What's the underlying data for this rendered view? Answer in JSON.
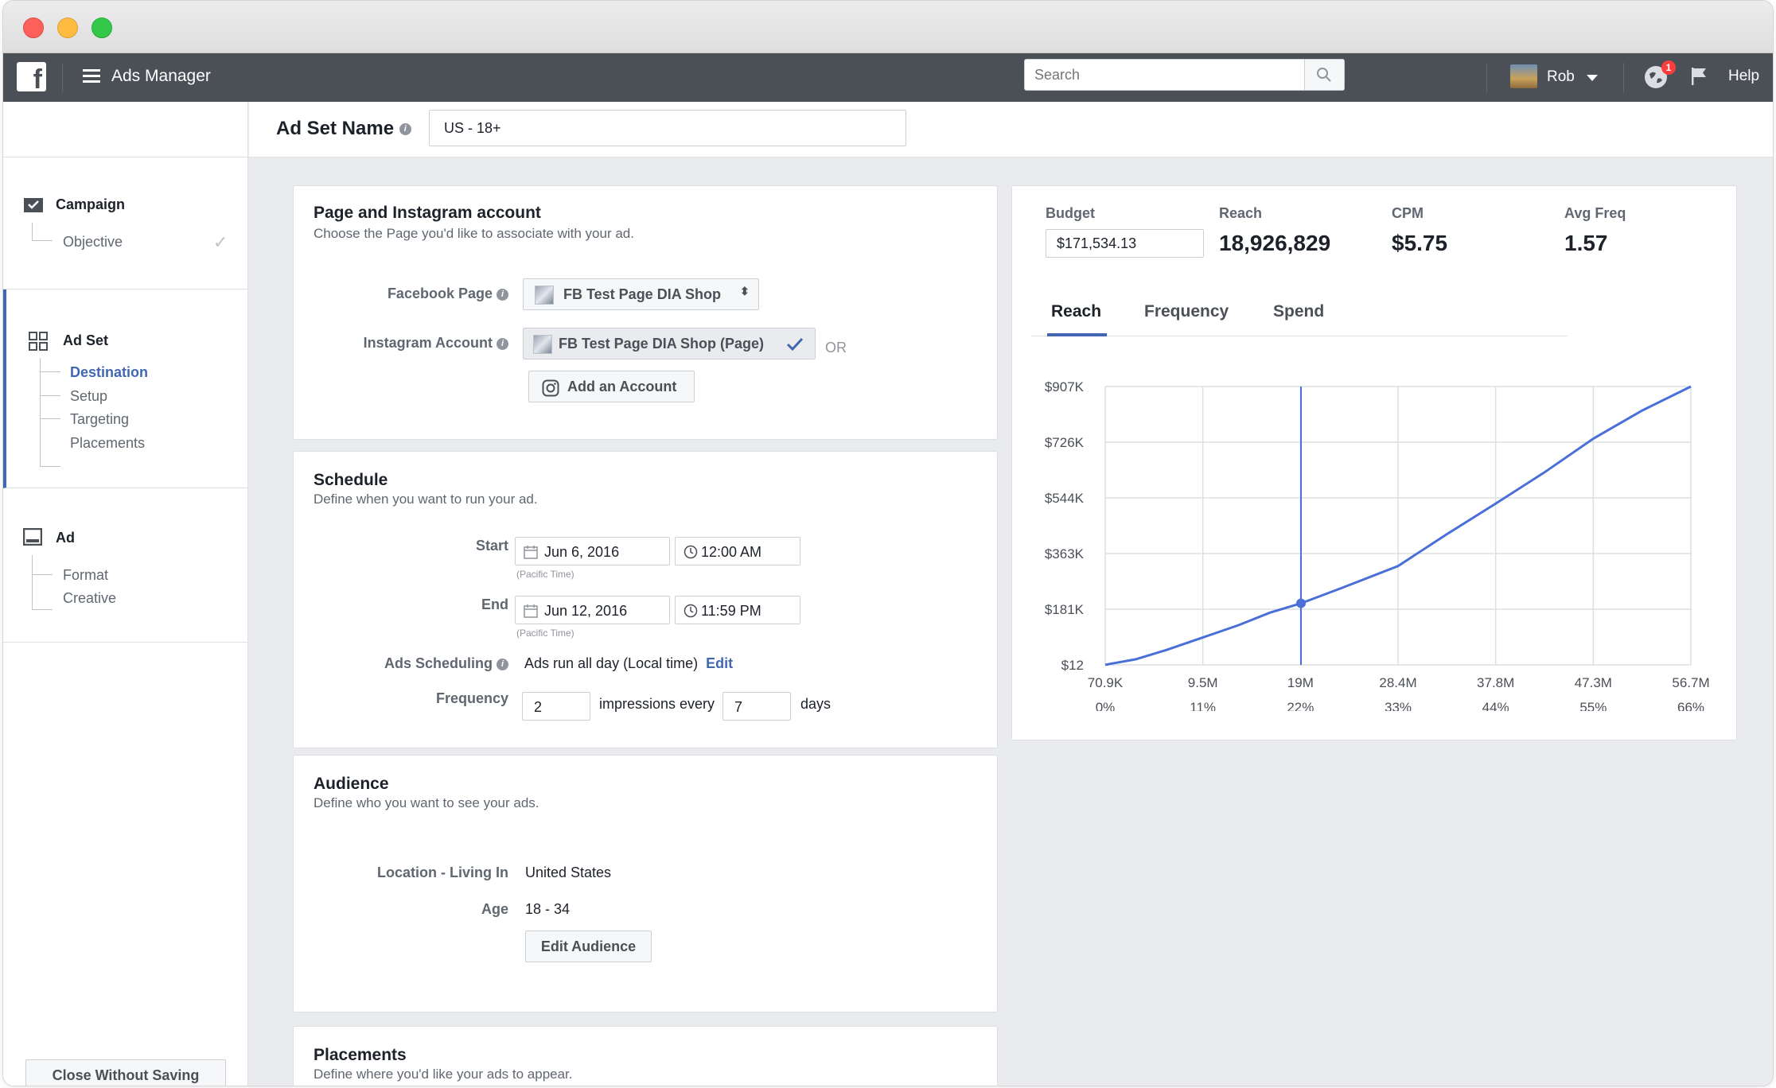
{
  "app": {
    "title": "Ads Manager",
    "logo": "f"
  },
  "search": {
    "placeholder": "Search"
  },
  "user": {
    "name": "Rob",
    "notifications": "1"
  },
  "help_label": "Help",
  "ad_set_name": {
    "label": "Ad Set Name",
    "value": "US - 18+"
  },
  "sidebar": {
    "campaign": {
      "title": "Campaign",
      "items": [
        "Objective"
      ]
    },
    "adset": {
      "title": "Ad Set",
      "items": [
        "Destination",
        "Setup",
        "Targeting",
        "Placements"
      ],
      "current": "Destination"
    },
    "ad": {
      "title": "Ad",
      "items": [
        "Format",
        "Creative"
      ]
    },
    "close_label": "Close Without Saving"
  },
  "page_section": {
    "title": "Page and Instagram account",
    "subtitle": "Choose the Page you'd like to associate with your ad.",
    "facebook_page_label": "Facebook Page",
    "facebook_page_value": "FB Test Page DIA Shop",
    "instagram_label": "Instagram Account",
    "instagram_value": "FB Test Page DIA Shop (Page)",
    "or_label": "OR",
    "add_account_label": "Add an Account"
  },
  "schedule": {
    "title": "Schedule",
    "subtitle": "Define when you want to run your ad.",
    "start_label": "Start",
    "start_date": "Jun 6, 2016",
    "start_time": "12:00 AM",
    "end_label": "End",
    "end_date": "Jun 12, 2016",
    "end_time": "11:59 PM",
    "tz_note": "(Pacific Time)",
    "scheduling_label": "Ads Scheduling",
    "scheduling_value": "Ads run all day (Local time)",
    "edit_label": "Edit",
    "frequency_label": "Frequency",
    "frequency_impressions": "2",
    "impressions_every": "impressions every",
    "frequency_days": "7",
    "days_label": "days"
  },
  "audience": {
    "title": "Audience",
    "subtitle": "Define who you want to see your ads.",
    "location_label": "Location - Living In",
    "location_value": "United States",
    "age_label": "Age",
    "age_value": "18 - 34",
    "edit_audience_label": "Edit Audience"
  },
  "placements": {
    "title": "Placements",
    "subtitle": "Define where you'd like your ads to appear."
  },
  "stats": {
    "budget_label": "Budget",
    "budget_value": "$171,534.13",
    "reach_label": "Reach",
    "reach_value": "18,926,829",
    "cpm_label": "CPM",
    "cpm_value": "$5.75",
    "avgfreq_label": "Avg Freq",
    "avgfreq_value": "1.57",
    "tabs": [
      "Reach",
      "Frequency",
      "Spend"
    ],
    "active_tab": "Reach"
  },
  "colors": {
    "accent": "#4267b2",
    "nav": "#4b4f56",
    "line": "#4a6fd8"
  },
  "chart_data": {
    "type": "line",
    "xlabel": "Reach",
    "ylabel": "",
    "x_tick_labels": [
      "70.9K",
      "9.5M",
      "19M",
      "28.4M",
      "37.8M",
      "47.3M",
      "56.7M"
    ],
    "x_tick_percents": [
      "0%",
      "11%",
      "22%",
      "33%",
      "44%",
      "55%",
      "66%"
    ],
    "y_tick_labels": [
      "$907K",
      "$726K",
      "$544K",
      "$363K",
      "$181K",
      "$12"
    ],
    "x": [
      0.0709,
      0.5,
      3.0,
      6.0,
      9.5,
      13.0,
      16.0,
      19.0,
      23.0,
      28.4,
      33.0,
      37.8,
      42.5,
      47.3,
      52.0,
      56.7
    ],
    "y": [
      12,
      15,
      30,
      60,
      100,
      140,
      180,
      210,
      260,
      330,
      430,
      530,
      630,
      740,
      830,
      907
    ],
    "units": {
      "x": "millions of people",
      "y": "thousands of dollars"
    },
    "xlim": [
      0.0709,
      56.7
    ],
    "ylim": [
      12,
      907
    ],
    "marker": {
      "x": 19.0,
      "y": 210
    },
    "grid": true
  }
}
